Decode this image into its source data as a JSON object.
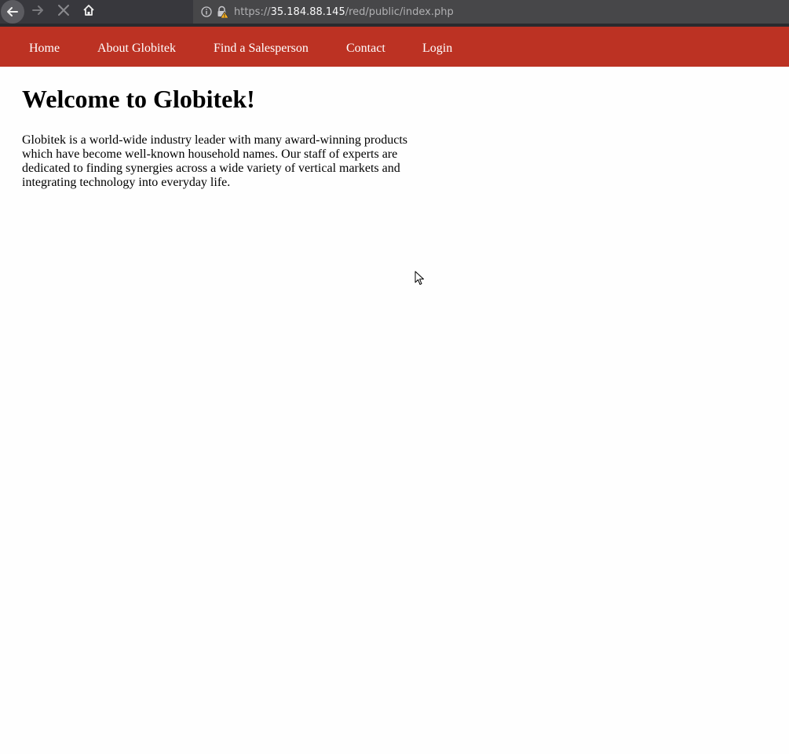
{
  "browser": {
    "url_scheme": "https://",
    "url_host": "35.184.88.145",
    "url_path": "/red/public/index.php",
    "colors": {
      "toolbar": "#38383d",
      "urlbar": "#474749"
    },
    "icons": [
      "back-arrow-icon",
      "forward-arrow-icon",
      "stop-icon",
      "home-icon",
      "info-icon",
      "insecure-lock-icon"
    ]
  },
  "nav": {
    "background": "#bc3223",
    "items": [
      {
        "label": "Home"
      },
      {
        "label": "About Globitek"
      },
      {
        "label": "Find a Salesperson"
      },
      {
        "label": "Contact"
      },
      {
        "label": "Login"
      }
    ]
  },
  "main": {
    "heading": "Welcome to Globitek!",
    "intro": "Globitek is a world-wide industry leader with many award-winning products which have become well-known household names. Our staff of experts are dedicated to finding synergies across a wide variety of vertical markets and integrating technology into everyday life."
  }
}
